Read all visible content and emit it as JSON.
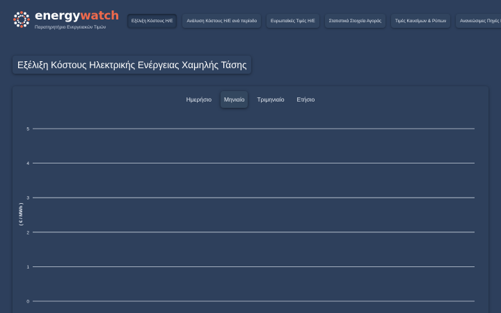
{
  "brand": {
    "name_part1": "energy",
    "name_part2": "watch",
    "subtitle": "Παρατηρητήριο Ενεργειακών Τιμών"
  },
  "nav": [
    {
      "label": "Εξέλιξη Κόστους Η/Ε",
      "active": true
    },
    {
      "label": "Ανάλυση Κόστους Η/Ε ανά περίοδο",
      "active": false
    },
    {
      "label": "Ευρωπαϊκές Τιμές Η/Ε",
      "active": false
    },
    {
      "label": "Στατιστικά Στοιχεία Αγοράς",
      "active": false
    },
    {
      "label": "Τιμές Καυσίμων & Ρύπων",
      "active": false
    },
    {
      "label": "Ανανεώσιμες Πηγές Ενέργειας",
      "active": false
    }
  ],
  "page_title": "Εξέλιξη Κόστους Ηλεκτρικής Ενέργειας Χαμηλής Τάσης",
  "period_tabs": [
    {
      "label": "Ημερήσιο",
      "active": false
    },
    {
      "label": "Μηνιαίο",
      "active": true
    },
    {
      "label": "Τριμηνιαίο",
      "active": false
    },
    {
      "label": "Ετήσιο",
      "active": false
    }
  ],
  "colors": {
    "background": "#2d3f5c",
    "accent": "#ef6a4c",
    "gridline": "#c9d2de"
  },
  "chart_data": {
    "type": "line",
    "title": "",
    "xlabel": "",
    "ylabel": "( € / MWh )",
    "ylim": [
      0,
      5
    ],
    "yticks": [
      "0",
      "1",
      "2",
      "3",
      "4",
      "5"
    ],
    "grid": true,
    "series": []
  }
}
